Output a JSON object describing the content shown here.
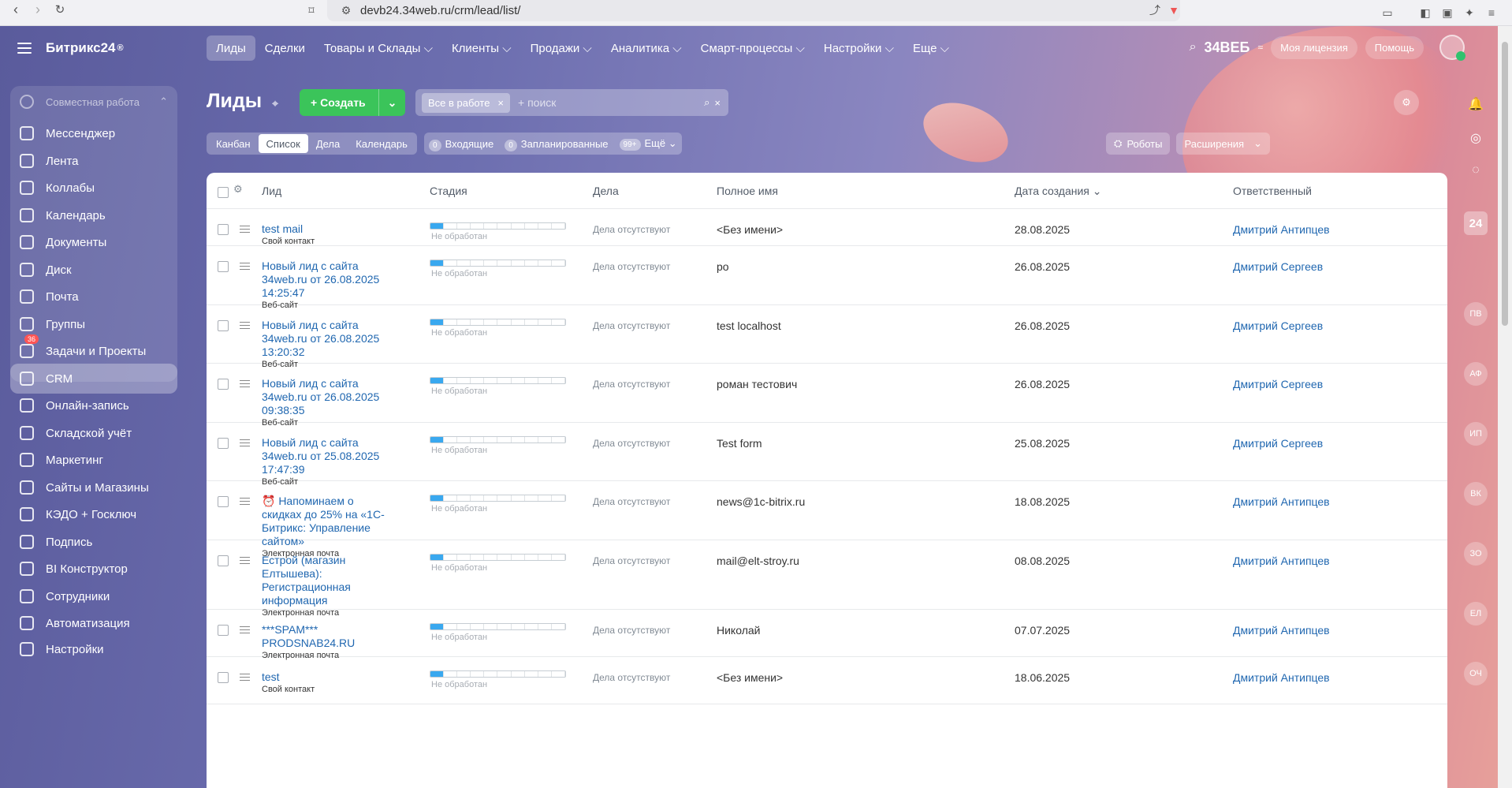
{
  "browser": {
    "url": "devb24.34web.ru/crm/lead/list/"
  },
  "sidebar": {
    "logo": "Битрикс24",
    "logo_mark": "®",
    "group_label": "Совместная работа",
    "items": [
      {
        "label": "Мессенджер",
        "icon": "messenger-icon"
      },
      {
        "label": "Лента",
        "icon": "feed-icon"
      },
      {
        "label": "Коллабы",
        "icon": "collab-icon"
      },
      {
        "label": "Календарь",
        "icon": "calendar-icon"
      },
      {
        "label": "Документы",
        "icon": "documents-icon"
      },
      {
        "label": "Диск",
        "icon": "disk-icon"
      },
      {
        "label": "Почта",
        "icon": "mail-icon"
      },
      {
        "label": "Группы",
        "icon": "groups-icon"
      },
      {
        "label": "Задачи и Проекты",
        "icon": "tasks-icon",
        "badge": "36"
      },
      {
        "label": "CRM",
        "icon": "crm-icon",
        "active": true
      },
      {
        "label": "Онлайн-запись",
        "icon": "booking-icon"
      },
      {
        "label": "Складской учёт",
        "icon": "warehouse-icon"
      },
      {
        "label": "Маркетинг",
        "icon": "marketing-icon"
      },
      {
        "label": "Сайты и Магазины",
        "icon": "sites-icon"
      },
      {
        "label": "КЭДО + Госключ",
        "icon": "kedo-icon"
      },
      {
        "label": "Подпись",
        "icon": "sign-icon"
      },
      {
        "label": "BI Конструктор",
        "icon": "bi-icon"
      },
      {
        "label": "Сотрудники",
        "icon": "employees-icon"
      },
      {
        "label": "Автоматизация",
        "icon": "automation-icon"
      },
      {
        "label": "Настройки",
        "icon": "settings-icon"
      }
    ]
  },
  "topnav": {
    "items": [
      {
        "label": "Лиды",
        "active": true
      },
      {
        "label": "Сделки"
      },
      {
        "label": "Товары и Склады ⌵"
      },
      {
        "label": "Клиенты ⌵"
      },
      {
        "label": "Продажи ⌵"
      },
      {
        "label": "Аналитика ⌵"
      },
      {
        "label": "Смарт-процессы ⌵"
      },
      {
        "label": "Настройки ⌵"
      },
      {
        "label": "Еще ⌵"
      }
    ],
    "company": "34ВЕБ",
    "license": "Моя лицензия",
    "help": "Помощь"
  },
  "page": {
    "title": "Лиды",
    "create": "Создать",
    "filter_chip": "Все в работе",
    "search_placeholder": "+ поиск",
    "views": [
      "Канбан",
      "Список",
      "Дела",
      "Календарь"
    ],
    "active_view": "Список",
    "counters": [
      {
        "count": "0",
        "label": "Входящие"
      },
      {
        "count": "0",
        "label": "Запланированные"
      },
      {
        "count": "99+",
        "label": "Ещё"
      }
    ],
    "robots": "Роботы",
    "extensions": "Расширения"
  },
  "grid": {
    "columns": [
      "Лид",
      "Стадия",
      "Дела",
      "Полное имя",
      "Дата создания",
      "Ответственный"
    ],
    "rows": [
      {
        "title": "test mail",
        "source": "Свой контакт",
        "stage": "Не обработан",
        "deals": "Дела отсутствуют",
        "name": "<Без имени>",
        "date": "28.08.2025",
        "resp": "Дмитрий Антипцев"
      },
      {
        "title": "Новый лид с сайта 34web.ru от 26.08.2025 14:25:47",
        "source": "Веб-сайт",
        "stage": "Не обработан",
        "deals": "Дела отсутствуют",
        "name": "ро",
        "date": "26.08.2025",
        "resp": "Дмитрий Сергеев"
      },
      {
        "title": "Новый лид с сайта 34web.ru от 26.08.2025 13:20:32",
        "source": "Веб-сайт",
        "stage": "Не обработан",
        "deals": "Дела отсутствуют",
        "name": "test localhost",
        "date": "26.08.2025",
        "resp": "Дмитрий Сергеев"
      },
      {
        "title": "Новый лид с сайта 34web.ru от 26.08.2025 09:38:35",
        "source": "Веб-сайт",
        "stage": "Не обработан",
        "deals": "Дела отсутствуют",
        "name": "роман тестович",
        "date": "26.08.2025",
        "resp": "Дмитрий Сергеев"
      },
      {
        "title": "Новый лид с сайта 34web.ru от 25.08.2025 17:47:39",
        "source": "Веб-сайт",
        "stage": "Не обработан",
        "deals": "Дела отсутствуют",
        "name": "Test form",
        "date": "25.08.2025",
        "resp": "Дмитрий Сергеев"
      },
      {
        "title": "⏰ Напоминаем о скидках до 25% на «1С-Битрикс: Управление сайтом»",
        "source": "Электронная почта",
        "stage": "Не обработан",
        "deals": "Дела отсутствуют",
        "name": "news@1c-bitrix.ru",
        "date": "18.08.2025",
        "resp": "Дмитрий Антипцев"
      },
      {
        "title": "Естрой (магазин Елтышева): Регистрационная информация",
        "source": "Электронная почта",
        "stage": "Не обработан",
        "deals": "Дела отсутствуют",
        "name": "mail@elt-stroy.ru",
        "date": "08.08.2025",
        "resp": "Дмитрий Антипцев"
      },
      {
        "title": "***SPAM*** PRODSNAB24.RU",
        "source": "Электронная почта",
        "stage": "Не обработан",
        "deals": "Дела отсутствуют",
        "name": "Николай",
        "date": "07.07.2025",
        "resp": "Дмитрий Антипцев"
      },
      {
        "title": "test",
        "source": "Свой контакт",
        "stage": "Не обработан",
        "deals": "Дела отсутствуют",
        "name": "<Без имени>",
        "date": "18.06.2025",
        "resp": "Дмитрий Антипцев"
      }
    ]
  },
  "right_strip": {
    "counter": "24",
    "avatars": [
      "ПВ",
      "АФ",
      "ИП",
      "ВК",
      "ЗО",
      "ЕЛ",
      "ОЧ"
    ]
  }
}
